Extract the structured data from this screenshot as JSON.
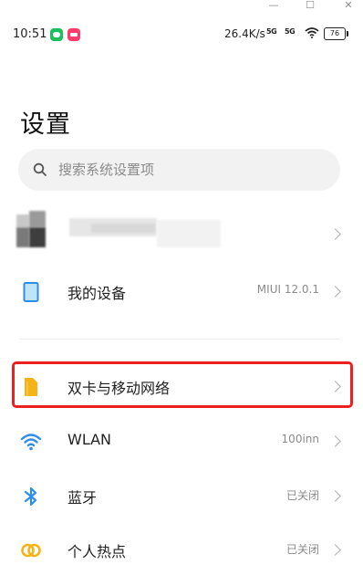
{
  "window": {
    "minimize": "—",
    "maximize": "☐",
    "close": "✕"
  },
  "status_bar": {
    "time": "10:51",
    "net_speed": "26.4K/s",
    "signal_1": "5G",
    "signal_2": "5G",
    "battery": "76"
  },
  "page_title": "设置",
  "search": {
    "placeholder": "搜索系统设置项"
  },
  "account": {
    "name": ""
  },
  "rows": [
    {
      "label": "我的设备",
      "value": "MIUI 12.0.1",
      "icon": "device-icon"
    },
    {
      "label": "双卡与移动网络",
      "value": "",
      "icon": "sim-card-icon",
      "highlighted": true
    },
    {
      "label": "WLAN",
      "value": "100inn",
      "icon": "wifi-icon"
    },
    {
      "label": "蓝牙",
      "value": "已关闭",
      "icon": "bluetooth-icon"
    },
    {
      "label": "个人热点",
      "value": "已关闭",
      "icon": "hotspot-icon"
    }
  ],
  "colors": {
    "accent_blue": "#2f8ee8",
    "sim_yellow": "#f5b318",
    "highlight_red": "#ee1f1f",
    "search_bg": "#f2f2f2"
  }
}
